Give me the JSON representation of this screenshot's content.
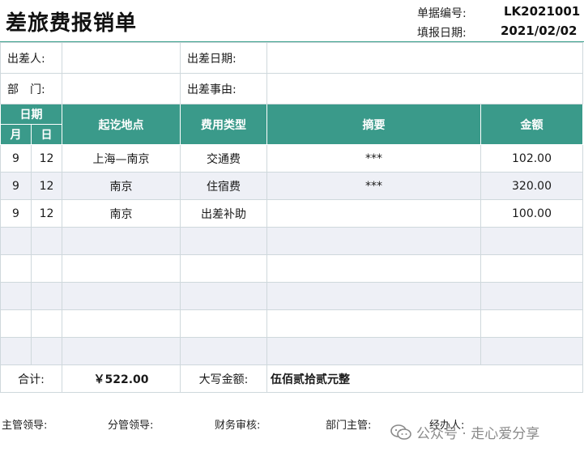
{
  "header": {
    "title": "差旅费报销单",
    "doc_no_label": "单据编号:",
    "doc_no": "LK2021001",
    "date_label": "填报日期:",
    "date": "2021/02/02"
  },
  "info": {
    "traveler_label": "出差人:",
    "travel_date_label": "出差日期:",
    "dept_label": "部　门:",
    "reason_label": "出差事由:",
    "traveler": "",
    "travel_date": "",
    "dept": "",
    "reason": ""
  },
  "table": {
    "date_header": "日期",
    "month_header": "月",
    "day_header": "日",
    "route_header": "起讫地点",
    "type_header": "费用类型",
    "summary_header": "摘要",
    "amount_header": "金额",
    "rows": [
      {
        "month": "9",
        "day": "12",
        "route": "上海—南京",
        "type": "交通费",
        "summary": "***",
        "amount": "102.00"
      },
      {
        "month": "9",
        "day": "12",
        "route": "南京",
        "type": "住宿费",
        "summary": "***",
        "amount": "320.00"
      },
      {
        "month": "9",
        "day": "12",
        "route": "南京",
        "type": "出差补助",
        "summary": "",
        "amount": "100.00"
      },
      {
        "month": "",
        "day": "",
        "route": "",
        "type": "",
        "summary": "",
        "amount": ""
      },
      {
        "month": "",
        "day": "",
        "route": "",
        "type": "",
        "summary": "",
        "amount": ""
      },
      {
        "month": "",
        "day": "",
        "route": "",
        "type": "",
        "summary": "",
        "amount": ""
      },
      {
        "month": "",
        "day": "",
        "route": "",
        "type": "",
        "summary": "",
        "amount": ""
      },
      {
        "month": "",
        "day": "",
        "route": "",
        "type": "",
        "summary": "",
        "amount": ""
      }
    ]
  },
  "total": {
    "label": "合计:",
    "amount": "￥522.00",
    "upper_label": "大写金额:",
    "upper_amount": "伍佰贰拾贰元整"
  },
  "signoff": {
    "supervisor": "主管领导:",
    "division_leader": "分管领导:",
    "finance_review": "财务审核:",
    "dept_head": "部门主管:",
    "handler": "经办人:"
  },
  "watermark": {
    "text": "公众号 · 走心爱分享",
    "icon": "wechat-icon"
  },
  "colors": {
    "header_fill": "#3a9a8a",
    "shade_row": "#eef0f6",
    "grid": "#cfd8dc"
  }
}
